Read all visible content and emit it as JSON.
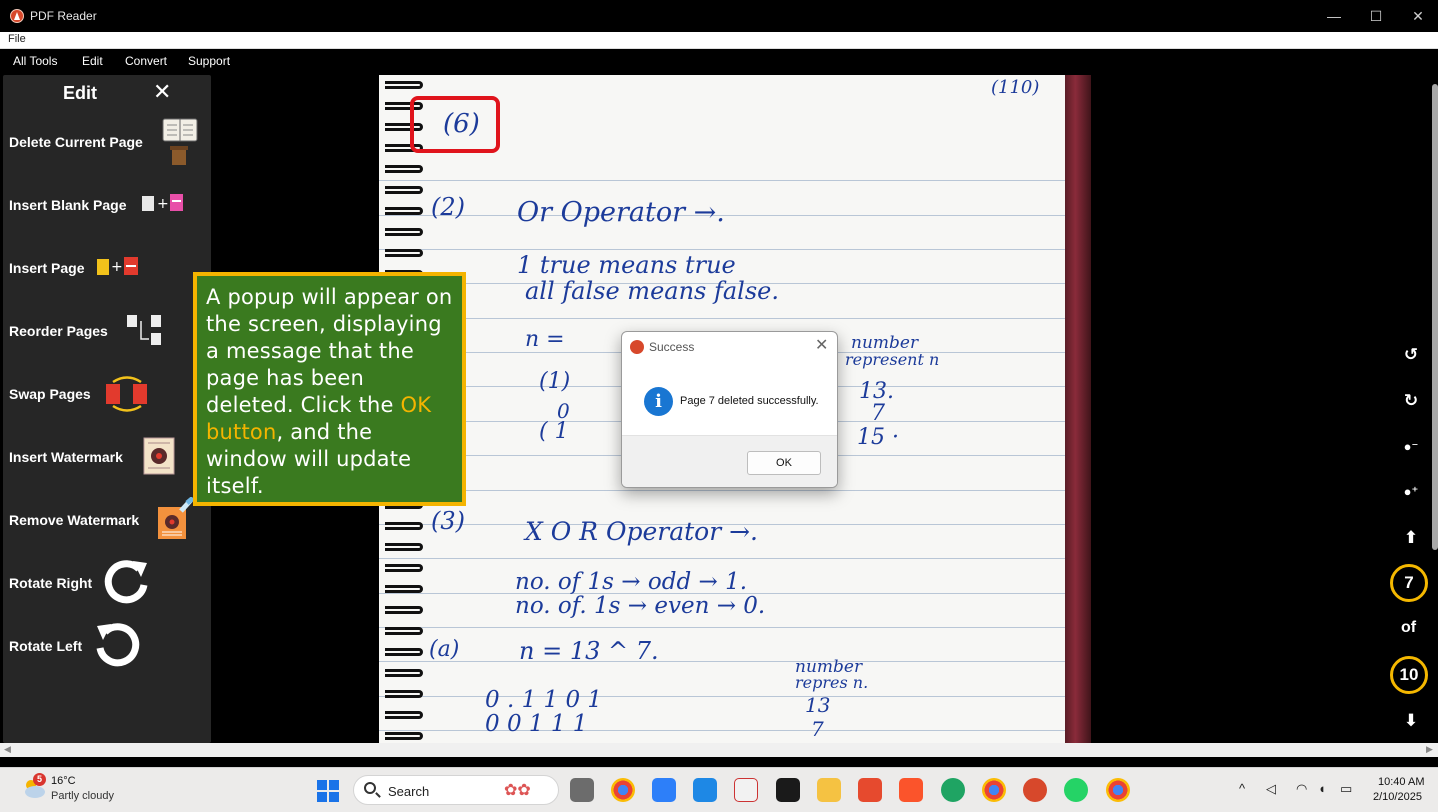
{
  "window": {
    "title": "PDF Reader",
    "controls": [
      "—",
      "☐",
      "✕"
    ]
  },
  "menubar": {
    "file": "File"
  },
  "toolbar": {
    "items": [
      "All Tools",
      "Edit",
      "Convert",
      "Support"
    ]
  },
  "sidebar": {
    "title": "Edit",
    "close": "✕",
    "items": [
      {
        "label": "Delete Current Page",
        "icon": "delete-page-icon"
      },
      {
        "label": "Insert Blank Page",
        "icon": "insert-blank-page-icon"
      },
      {
        "label": "Insert Page",
        "icon": "insert-page-icon"
      },
      {
        "label": "Reorder Pages",
        "icon": "reorder-pages-icon"
      },
      {
        "label": "Swap Pages",
        "icon": "swap-pages-icon"
      },
      {
        "label": "Insert Watermark",
        "icon": "insert-watermark-icon"
      },
      {
        "label": "Remove Watermark",
        "icon": "remove-watermark-icon"
      },
      {
        "label": "Rotate Right",
        "icon": "rotate-right-icon"
      },
      {
        "label": "Rotate Left",
        "icon": "rotate-left-icon"
      }
    ]
  },
  "document": {
    "handwriting": {
      "corner_number": "(110)",
      "item6": "(6)",
      "item2": "(2)",
      "or_operator": "Or Operator →.",
      "line1": "1 true means true",
      "line2": "all false means false.",
      "n_eq": "n =",
      "number_rep": "number",
      "represent": "represent n",
      "c1": "(1)",
      "bin_13": "13.",
      "bin_7": "7",
      "bin_15": "15 ·",
      "row_0": "0",
      "row_1": "( 1",
      "item3": "(3)",
      "xor_operator": "X O R  Operator →.",
      "odd_line": "no. of 1s → odd → 1.",
      "even_line": "no. of. 1s → even → 0.",
      "item_a": "(a)",
      "n_expr": "n = 13 ^ 7.",
      "number_rep2": "number",
      "repres2": "repres n.",
      "bin_row1": "0 . 1  1  0  1",
      "bin_row2": "0  0  1  1  1",
      "v13": "13",
      "v7": "7"
    }
  },
  "right_controls": {
    "current_page": "7",
    "of_label": "of",
    "total_pages": "10"
  },
  "callout": {
    "text_before": "A popup will appear on the screen, displaying a message that the page has been deleted. Click the ",
    "highlight": "OK button",
    "text_after": ", and the window will update itself.",
    "highlight_color": "#f4b400",
    "background_color": "#3a7a1f"
  },
  "dialog": {
    "title": "Success",
    "close": "✕",
    "info_glyph": "i",
    "message": "Page 7 deleted successfully.",
    "ok_label": "OK"
  },
  "taskbar": {
    "weather_badge": "5",
    "temperature": "16°C",
    "condition": "Partly cloudy",
    "search_label": "Search",
    "time": "10:40 AM",
    "date": "2/10/2025",
    "tray_caret": "^"
  }
}
